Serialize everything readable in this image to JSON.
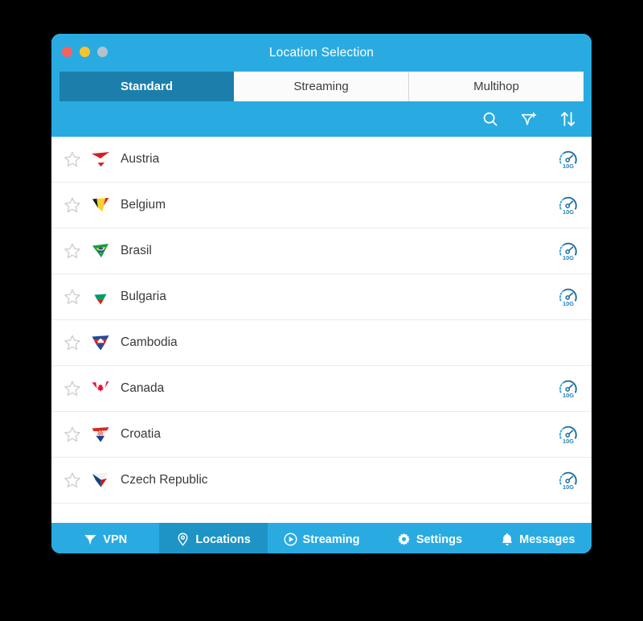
{
  "window": {
    "title": "Location Selection",
    "traffic_lights": [
      {
        "name": "close",
        "color": "#f9615c"
      },
      {
        "name": "minimize",
        "color": "#f9c22e"
      },
      {
        "name": "zoom",
        "color": "#b3c1cb"
      }
    ]
  },
  "theme": {
    "accent": "#29abe2",
    "accent_dark": "#1c7fab",
    "nav_active": "#1e94c6",
    "row_border": "#ebebeb",
    "text": "#3a3a3a",
    "badge_blue": "#2a7fb8"
  },
  "tabs": [
    {
      "label": "Standard",
      "active": true
    },
    {
      "label": "Streaming",
      "active": false
    },
    {
      "label": "Multihop",
      "active": false
    }
  ],
  "toolbar": {
    "icons": [
      {
        "name": "search-icon",
        "title": "Search"
      },
      {
        "name": "add-filter-icon",
        "title": "Add filter"
      },
      {
        "name": "sort-icon",
        "title": "Sort"
      }
    ]
  },
  "list": {
    "badge_label": "10G",
    "rows": [
      {
        "country": "Austria",
        "flag": "austria-flag",
        "favorite": false,
        "speed_badge": true
      },
      {
        "country": "Belgium",
        "flag": "belgium-flag",
        "favorite": false,
        "speed_badge": true
      },
      {
        "country": "Brasil",
        "flag": "brasil-flag",
        "favorite": false,
        "speed_badge": true
      },
      {
        "country": "Bulgaria",
        "flag": "bulgaria-flag",
        "favorite": false,
        "speed_badge": true
      },
      {
        "country": "Cambodia",
        "flag": "cambodia-flag",
        "favorite": false,
        "speed_badge": false
      },
      {
        "country": "Canada",
        "flag": "canada-flag",
        "favorite": false,
        "speed_badge": true
      },
      {
        "country": "Croatia",
        "flag": "croatia-flag",
        "favorite": false,
        "speed_badge": true
      },
      {
        "country": "Czech Republic",
        "flag": "czech-republic-flag",
        "favorite": false,
        "speed_badge": true
      }
    ]
  },
  "bottom_nav": [
    {
      "label": "VPN",
      "icon": "vpn-funnel-icon",
      "active": false
    },
    {
      "label": "Locations",
      "icon": "map-pin-icon",
      "active": true
    },
    {
      "label": "Streaming",
      "icon": "play-circle-icon",
      "active": false
    },
    {
      "label": "Settings",
      "icon": "gear-icon",
      "active": false
    },
    {
      "label": "Messages",
      "icon": "bell-icon",
      "active": false
    }
  ]
}
